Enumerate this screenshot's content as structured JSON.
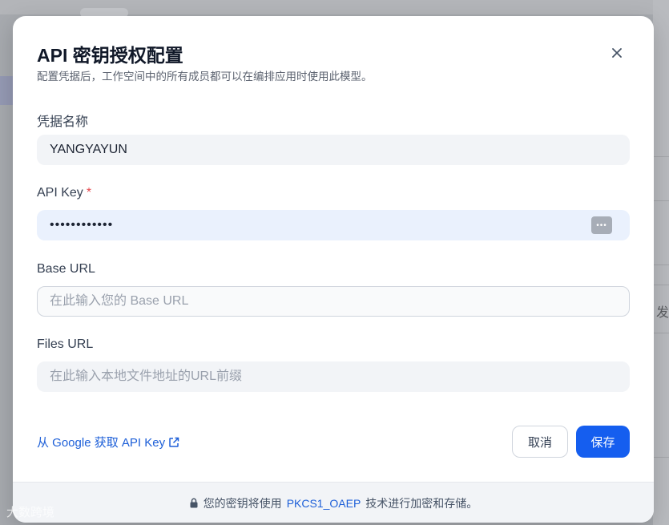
{
  "dialog": {
    "title": "API 密钥授权配置",
    "subtitle": "配置凭据后，工作空间中的所有成员都可以在编排应用时使用此模型。"
  },
  "fields": {
    "credential_name": {
      "label": "凭据名称",
      "value": "YANGYAYUN"
    },
    "api_key": {
      "label": "API Key",
      "required_mark": "*",
      "value": "••••••••••••",
      "toggle_text": "•••"
    },
    "base_url": {
      "label": "Base URL",
      "placeholder": "在此输入您的 Base URL"
    },
    "files_url": {
      "label": "Files URL",
      "placeholder": "在此输入本地文件地址的URL前缀"
    }
  },
  "actions": {
    "get_key_link": "从 Google 获取 API Key",
    "cancel_label": "取消",
    "save_label": "保存"
  },
  "footer": {
    "text_before": "您的密钥将使用",
    "highlight": "PKCS1_OAEP",
    "text_after": "技术进行加密和存储。"
  },
  "background": {
    "right_char": "发"
  },
  "watermark": {
    "text": "大数跨境"
  },
  "colors": {
    "primary": "#155eef",
    "link": "#1d5fd8",
    "required": "#e5484d",
    "focused_input_bg": "#eaf1fd"
  },
  "icons": {
    "close": "close-icon",
    "external_link": "external-link-icon",
    "lock": "lock-icon",
    "password_toggle": "dots-icon"
  }
}
